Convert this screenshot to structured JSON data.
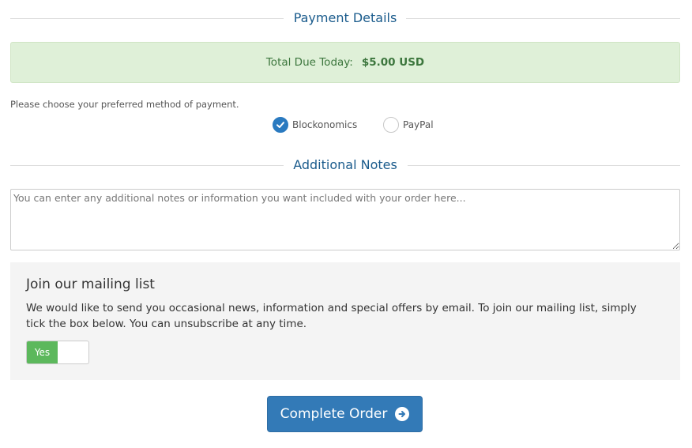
{
  "payment": {
    "title": "Payment Details",
    "total_label": "Total Due Today:",
    "total_amount": "$5.00 USD",
    "choose_text": "Please choose your preferred method of payment.",
    "methods": [
      {
        "label": "Blockonomics",
        "selected": true
      },
      {
        "label": "PayPal",
        "selected": false
      }
    ]
  },
  "notes": {
    "title": "Additional Notes",
    "placeholder": "You can enter any additional notes or information you want included with your order here..."
  },
  "mailing": {
    "title": "Join our mailing list",
    "text": "We would like to send you occasional news, information and special offers by email. To join our mailing list, simply tick the box below. You can unsubscribe at any time.",
    "toggle_label": "Yes"
  },
  "actions": {
    "complete_label": "Complete Order"
  },
  "colors": {
    "accent": "#337ab7",
    "success_bg": "#dff0d8",
    "toggle_on": "#5cb85c",
    "heading": "#1a5b8c"
  },
  "icons": {
    "radio_selected": "check-icon",
    "complete": "arrow-circle-right-icon"
  }
}
